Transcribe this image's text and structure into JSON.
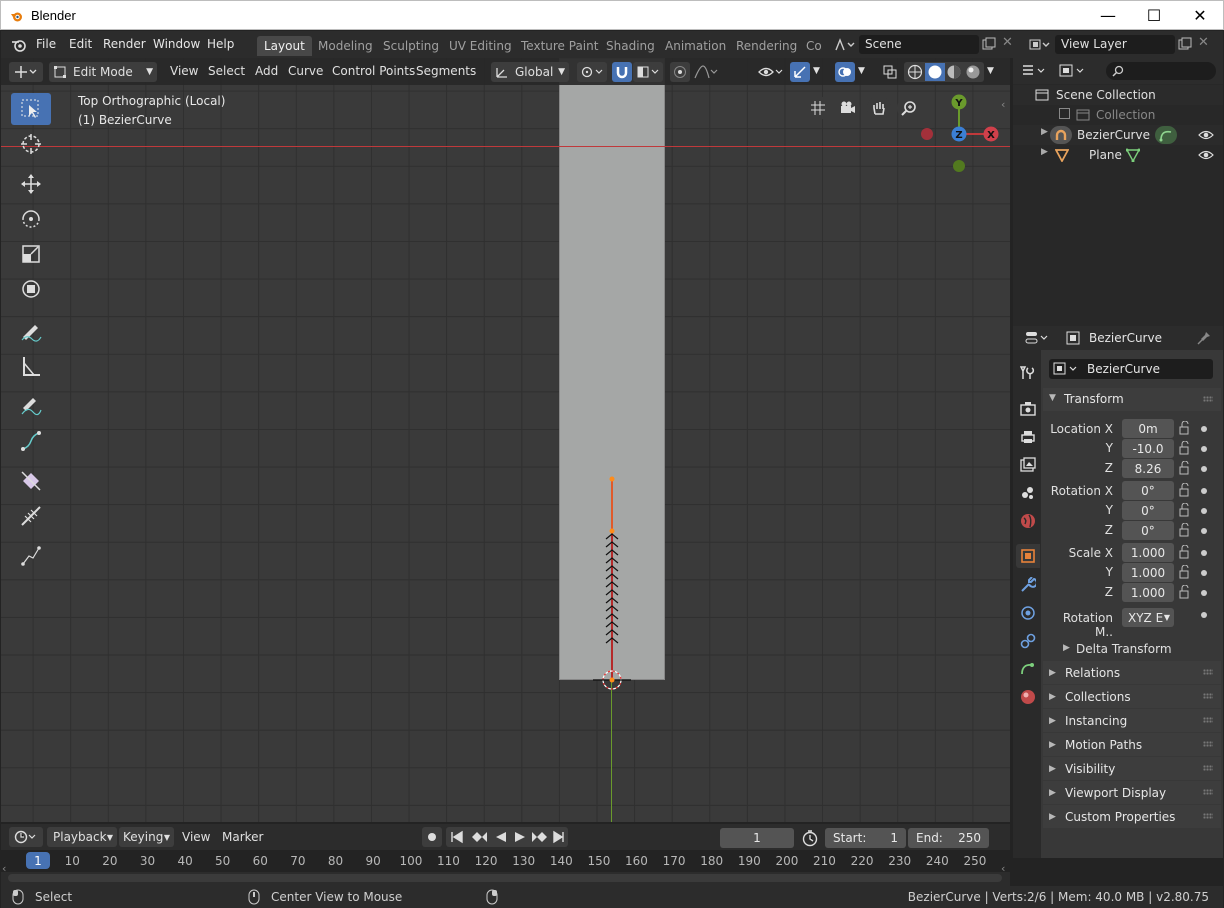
{
  "window": {
    "title": "Blender",
    "minimize": "—",
    "maximize": "☐",
    "close": "✕"
  },
  "menu": [
    "File",
    "Edit",
    "Render",
    "Window",
    "Help"
  ],
  "workspaces": [
    "Layout",
    "Modeling",
    "Sculpting",
    "UV Editing",
    "Texture Paint",
    "Shading",
    "Animation",
    "Rendering",
    "Co"
  ],
  "active_workspace": "Layout",
  "scene": {
    "label": "Scene"
  },
  "view_layer": {
    "label": "View Layer"
  },
  "viewport_header": {
    "mode": "Edit Mode",
    "menus": [
      "View",
      "Select",
      "Add",
      "Curve",
      "Control Points",
      "Segments"
    ],
    "orientation": "Global"
  },
  "viewport": {
    "view_name": "Top Orthographic (Local)",
    "object_name": "(1) BezierCurve",
    "gizmo_axes": {
      "y": "Y",
      "z": "Z",
      "x": "X"
    }
  },
  "outliner": {
    "scene_collection": "Scene Collection",
    "collection": "Collection",
    "objects": [
      "BezierCurve",
      "Plane"
    ]
  },
  "properties": {
    "header_object": "BezierCurve",
    "object_name": "BezierCurve",
    "transform_label": "Transform",
    "location": {
      "label_x": "Location X",
      "x": "0m",
      "y": "-10.0",
      "z": "8.26"
    },
    "rotation": {
      "label_x": "Rotation X",
      "x": "0°",
      "y": "0°",
      "z": "0°"
    },
    "scale": {
      "label_x": "Scale X",
      "x": "1.000",
      "y": "1.000",
      "z": "1.000"
    },
    "axis_y": "Y",
    "axis_z": "Z",
    "rotation_mode": {
      "label": "Rotation M..",
      "value": "XYZ E"
    },
    "delta_transform": "Delta Transform",
    "panels": [
      "Relations",
      "Collections",
      "Instancing",
      "Motion Paths",
      "Visibility",
      "Viewport Display",
      "Custom Properties"
    ]
  },
  "timeline": {
    "menus": [
      "Playback",
      "Keying",
      "View",
      "Marker"
    ],
    "current_frame": "1",
    "start_label": "Start:",
    "start": "1",
    "end_label": "End:",
    "end": "250",
    "ruler": [
      "1",
      "10",
      "20",
      "30",
      "40",
      "50",
      "60",
      "70",
      "80",
      "90",
      "100",
      "110",
      "120",
      "130",
      "140",
      "150",
      "160",
      "170",
      "180",
      "190",
      "200",
      "210",
      "220",
      "230",
      "240",
      "250"
    ]
  },
  "statusbar": {
    "left": "Select",
    "middle": "Center View to Mouse",
    "right": "BezierCurve | Verts:2/6 | Mem: 40.0 MB | v2.80.75"
  },
  "colors": {
    "accent": "#4772b3",
    "x_axis": "#c0393b",
    "y_axis": "#6a9a2c",
    "curve_handle": "#e87d0d"
  }
}
